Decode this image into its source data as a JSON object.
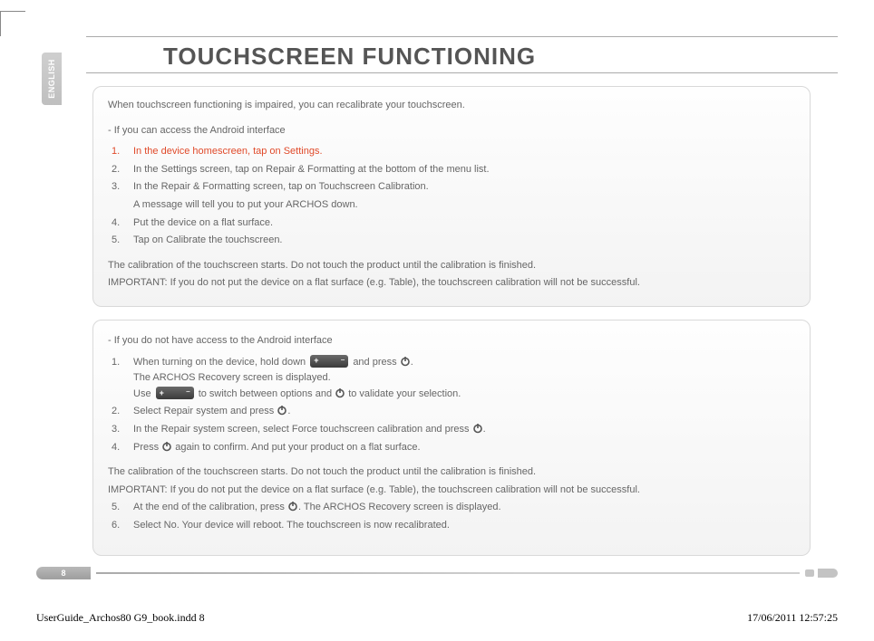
{
  "language_tab": "ENGLISH",
  "title": "TOUCHSCREEN FUNCTIONING",
  "page_number": "8",
  "panel1": {
    "intro": "When touchscreen functioning is impaired, you can recalibrate your touchscreen.",
    "dash": "If you can access the Android interface",
    "steps": [
      {
        "n": "1.",
        "text": "In the device homescreen, tap on Settings.",
        "red": true
      },
      {
        "n": "2.",
        "text": "In the Settings screen, tap on Repair & Formatting at the bottom of the menu list."
      },
      {
        "n": "3.",
        "text": "In the Repair & Formatting screen, tap on Touchscreen Calibration."
      },
      {
        "n": "",
        "text": "A message will tell you to put your ARCHOS down."
      },
      {
        "n": "4.",
        "text": "Put the device on a flat surface."
      },
      {
        "n": "5.",
        "text": "Tap on Calibrate the touchscreen."
      }
    ],
    "out1": "The calibration of the touchscreen starts. Do not touch the product until the calibration is finished.",
    "out2": "IMPORTANT: If you do not put the device on a flat surface (e.g. Table), the touchscreen calibration will not be successful."
  },
  "panel2": {
    "dash": "If you do not have access to the Android interface",
    "s1a": "When turning on the device, hold down",
    "s1b": "and press",
    "s1_line2": "The ARCHOS Recovery screen is displayed.",
    "s1c_pre": "Use",
    "s1c_post": "to switch between options and",
    "s1c_end": "to validate your selection.",
    "s2a": "Select Repair system and press",
    "s3a": "In the Repair system screen, select Force touchscreen calibration and press",
    "s4a": "Press",
    "s4b": "again to confirm. And put your product on a flat surface.",
    "mid1": "The calibration of the touchscreen starts. Do not touch the product until the calibration is finished.",
    "mid2": "IMPORTANT: If you do not put the device on a flat surface (e.g. Table), the touchscreen calibration will not be successful.",
    "s5a": "At the end of the calibration, press",
    "s5b": ". The ARCHOS Recovery screen is displayed.",
    "s6": "Select No. Your device will reboot. The touchscreen is now recalibrated.",
    "nums": {
      "n1": "1.",
      "n2": "2.",
      "n3": "3.",
      "n4": "4.",
      "n5": "5.",
      "n6": "6."
    },
    "period": "."
  },
  "print_footer": {
    "left": "UserGuide_Archos80 G9_book.indd   8",
    "right": "17/06/2011   12:57:25"
  },
  "icons": {
    "volume": "volume-rocker",
    "power": "power-icon"
  }
}
